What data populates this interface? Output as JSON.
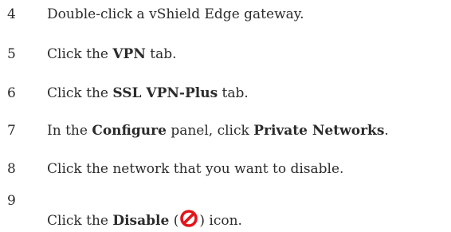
{
  "steps": [
    {
      "number": "4",
      "parts": {
        "t1": "Double-click a vShield Edge gateway."
      }
    },
    {
      "number": "5",
      "parts": {
        "t1": "Click the ",
        "b1": "VPN",
        "t2": " tab."
      }
    },
    {
      "number": "6",
      "parts": {
        "t1": "Click the ",
        "b1": "SSL VPN-Plus",
        "t2": " tab."
      }
    },
    {
      "number": "7",
      "parts": {
        "t1": "In the ",
        "b1": "Configure",
        "t2": " panel, click ",
        "b2": "Private Networks",
        "t3": "."
      }
    },
    {
      "number": "8",
      "parts": {
        "t1": "Click the network that you want to disable."
      }
    },
    {
      "number": "9",
      "parts": {
        "t1": "Click the ",
        "b1": "Disable",
        "t2": " (",
        "t3": ") icon."
      },
      "icon": "disable-icon"
    }
  ],
  "colors": {
    "text": "#2b2b2b",
    "disable_icon": "#e3141b"
  }
}
